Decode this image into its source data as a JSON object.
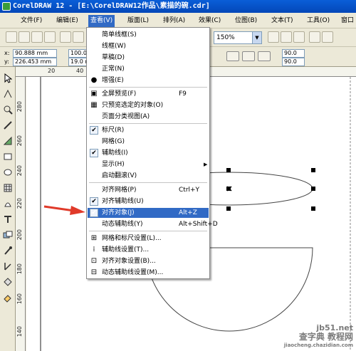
{
  "window": {
    "title": "CorelDRAW 12 - [E:\\CorelDRAW12作品\\素描的碗.cdr]"
  },
  "menubar": [
    "文件(F)",
    "编辑(E)",
    "查看(V)",
    "版面(L)",
    "排列(A)",
    "效果(C)",
    "位图(B)",
    "文本(T)",
    "工具(O)",
    "窗口"
  ],
  "toolbar": {
    "zoom": "150%"
  },
  "propbar": {
    "x": "90.888 mm",
    "y": "226.453 mm",
    "w": "100.0",
    "h": "19.0 r",
    "angle1": "90.0",
    "angle2": "90.0"
  },
  "rulers": {
    "top": [
      "20",
      "40"
    ],
    "left": [
      "280",
      "260",
      "240",
      "220",
      "200",
      "180",
      "160",
      "140"
    ]
  },
  "view_menu": {
    "items": [
      {
        "label": "简单线框(S)",
        "shortcut": "",
        "icon": ""
      },
      {
        "label": "线框(W)",
        "shortcut": "",
        "icon": ""
      },
      {
        "label": "草稿(D)",
        "shortcut": "",
        "icon": ""
      },
      {
        "label": "正常(N)",
        "shortcut": "",
        "icon": ""
      },
      {
        "label": "增强(E)",
        "shortcut": "",
        "icon": "radio"
      },
      {
        "label": "全屏预览(F)",
        "shortcut": "F9",
        "icon": "monitor-icon"
      },
      {
        "label": "只预览选定的对象(O)",
        "shortcut": "",
        "icon": "grid-icon"
      },
      {
        "label": "页面分类视图(A)",
        "shortcut": "",
        "icon": ""
      },
      {
        "label": "标尺(R)",
        "shortcut": "",
        "icon": "check"
      },
      {
        "label": "网格(G)",
        "shortcut": "",
        "icon": ""
      },
      {
        "label": "辅助线(I)",
        "shortcut": "",
        "icon": "check"
      },
      {
        "label": "显示(H)",
        "shortcut": "",
        "icon": "",
        "submenu": true
      },
      {
        "label": "启动翻滚(V)",
        "shortcut": "",
        "icon": ""
      },
      {
        "label": "对齐网格(P)",
        "shortcut": "Ctrl+Y",
        "icon": ""
      },
      {
        "label": "对齐辅助线(U)",
        "shortcut": "",
        "icon": "check"
      },
      {
        "label": "对齐对象(J)",
        "shortcut": "Alt+Z",
        "icon": "check",
        "highlighted": true
      },
      {
        "label": "动态辅助线(Y)",
        "shortcut": "Alt+Shift+D",
        "icon": ""
      },
      {
        "label": "网格和标尺设置(L)...",
        "shortcut": "",
        "icon": "grid-ruler-icon"
      },
      {
        "label": "辅助线设置(T)...",
        "shortcut": "",
        "icon": "guide-icon"
      },
      {
        "label": "对齐对象设置(B)...",
        "shortcut": "",
        "icon": "snap-icon"
      },
      {
        "label": "动态辅助线设置(M)...",
        "shortcut": "",
        "icon": "dynamic-guide-icon"
      }
    ]
  },
  "watermark": {
    "line1": "查字典 教程网",
    "line2": "jb51.net",
    "line3": "jiaocheng.chazidian.com"
  },
  "colors": {
    "highlight": "#316ac5",
    "titlebar": "#0a5ed8",
    "arrow": "#e03a2a"
  }
}
